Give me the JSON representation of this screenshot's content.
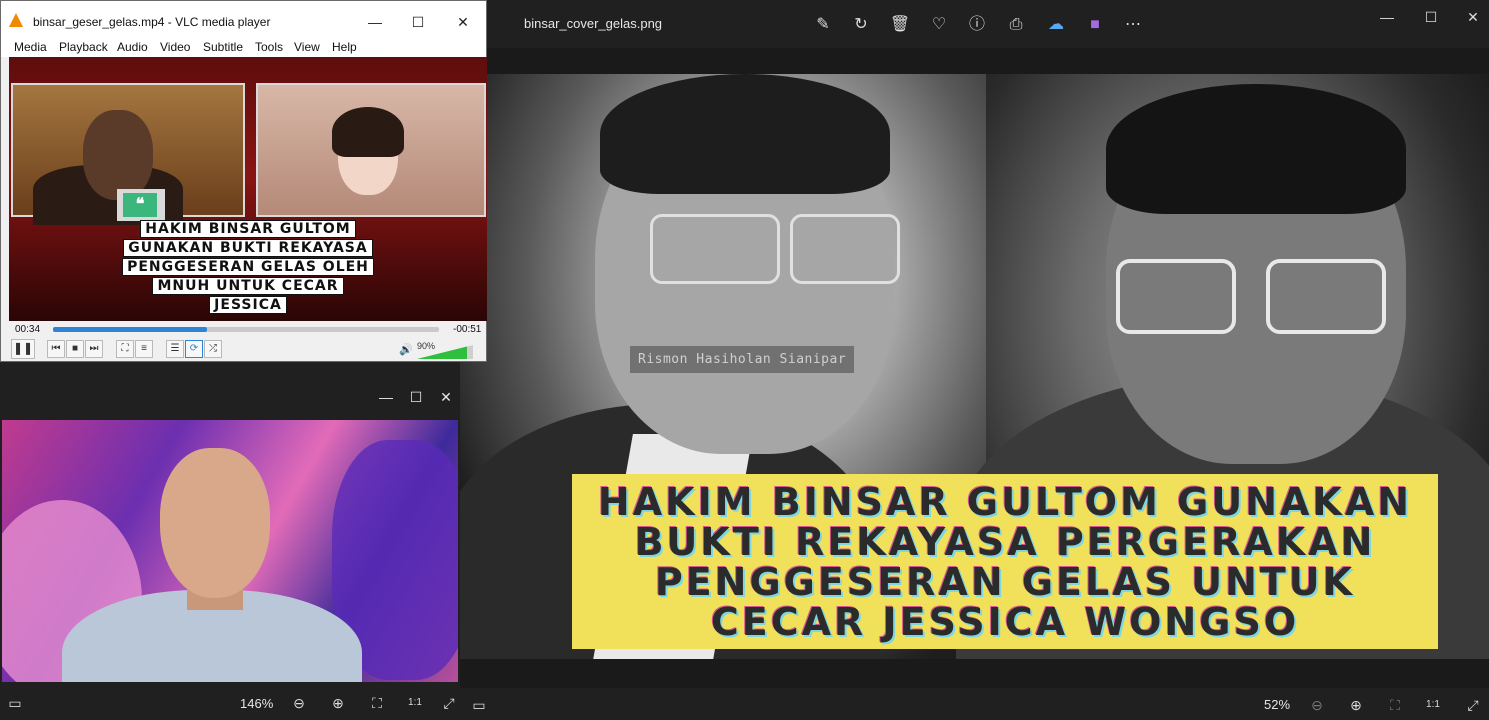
{
  "viewer": {
    "filename": "binsar_cover_gelas.png",
    "toolbar_icons": [
      "edit-icon",
      "rotate-icon",
      "delete-icon",
      "heart-icon",
      "info-icon",
      "print-icon",
      "onedrive-icon",
      "clipchamp-icon",
      "more-icon"
    ],
    "zoom": "52%",
    "watermark": "Rismon Hasiholan Sianipar",
    "headline": [
      "HAKIM BINSAR GULTOM GUNAKAN",
      "BUKTI REKAYASA PERGERAKAN",
      "PENGGESERAN GELAS UNTUK",
      "CECAR JESSICA WONGSO"
    ],
    "headline_bg": "#f1e05a"
  },
  "cam": {
    "zoom": "146%"
  },
  "vlc": {
    "title": "binsar_geser_gelas.mp4 - VLC media player",
    "menu": [
      "Media",
      "Playback",
      "Audio",
      "Video",
      "Subtitle",
      "Tools",
      "View",
      "Help"
    ],
    "caption": [
      "HAKIM BINSAR GULTOM",
      "GUNAKAN BUKTI REKAYASA",
      "PENGGESERAN GELAS OLEH",
      "MNUH UNTUK CECAR",
      "JESSICA"
    ],
    "quote_glyph": "❝",
    "time_current": "00:34",
    "time_remaining": "-00:51",
    "progress": 0.4,
    "volume": "90%",
    "volume_level": 0.9,
    "accent": "#2f84d6"
  }
}
